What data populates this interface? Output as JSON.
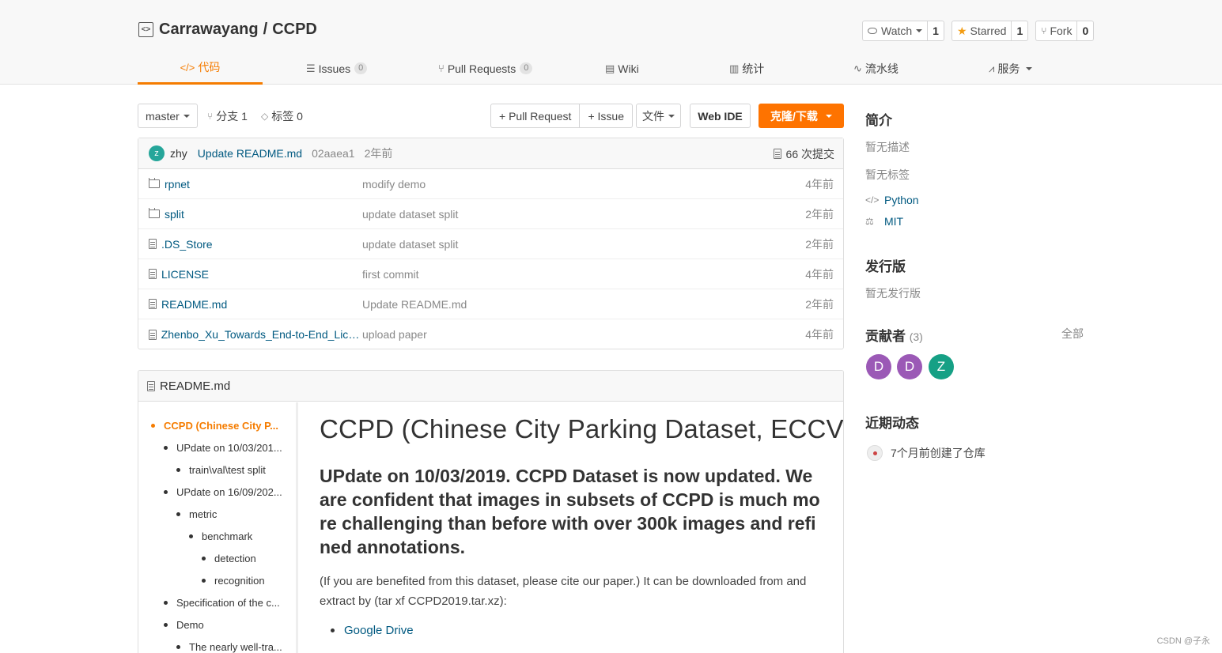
{
  "repo": {
    "owner": "Carrawayang",
    "separator": "/",
    "name": "CCPD",
    "watch_label": "Watch",
    "watch_count": "1",
    "star_label": "Starred",
    "star_count": "1",
    "fork_label": "Fork",
    "fork_count": "0"
  },
  "tabs": [
    {
      "label": "代码",
      "icon": "code-icon"
    },
    {
      "label": "Issues",
      "count": "0",
      "icon": "issues-icon"
    },
    {
      "label": "Pull Requests",
      "count": "0",
      "icon": "pull-request-icon"
    },
    {
      "label": "Wiki",
      "icon": "wiki-icon"
    },
    {
      "label": "统计",
      "icon": "stats-icon"
    },
    {
      "label": "流水线",
      "icon": "pipeline-icon"
    },
    {
      "label": "服务",
      "icon": "service-icon"
    }
  ],
  "toolbar": {
    "branch": "master",
    "branches_label": "分支 1",
    "tags_label": "标签 0",
    "pull_request": "+ Pull Request",
    "issue": "+ Issue",
    "file": "文件",
    "web_ide": "Web IDE",
    "clone": "克隆/下载"
  },
  "last_commit": {
    "avatar_letter": "z",
    "author": "zhy",
    "message": "Update README.md",
    "sha": "02aaea1",
    "time": "2年前",
    "commits": "66 次提交"
  },
  "files": [
    {
      "name": "rpnet",
      "type": "folder",
      "message": "modify demo",
      "time": "4年前"
    },
    {
      "name": "split",
      "type": "folder",
      "message": "update dataset split",
      "time": "2年前"
    },
    {
      "name": ".DS_Store",
      "type": "file",
      "message": "update dataset split",
      "time": "2年前"
    },
    {
      "name": "LICENSE",
      "type": "file",
      "message": "first commit",
      "time": "4年前"
    },
    {
      "name": "README.md",
      "type": "file",
      "message": "Update README.md",
      "time": "2年前"
    },
    {
      "name": "Zhenbo_Xu_Towards_End-to-End_Licen...",
      "type": "file",
      "message": "upload paper",
      "time": "4年前"
    }
  ],
  "readme": {
    "filename": "README.md",
    "toc": [
      {
        "text": "CCPD (Chinese City P...",
        "level": 0
      },
      {
        "text": "UPdate on 10/03/201...",
        "level": 1
      },
      {
        "text": "train\\val\\test split",
        "level": 2
      },
      {
        "text": "UPdate on 16/09/202...",
        "level": 1
      },
      {
        "text": "metric",
        "level": 2
      },
      {
        "text": "benchmark",
        "level": 3
      },
      {
        "text": "detection",
        "level": 4
      },
      {
        "text": "recognition",
        "level": 4
      },
      {
        "text": "Specification of the c...",
        "level": 1
      },
      {
        "text": "Demo",
        "level": 1
      },
      {
        "text": "The nearly well-tra...",
        "level": 2
      }
    ],
    "h1": "CCPD (Chinese City Parking Dataset, ECCV)",
    "h2": "UPdate on 10/03/2019. CCPD Dataset is now updated. We are confident that images in subsets of CCPD is much more challenging than before with over 300k images and refined annotations.",
    "paragraph": "(If you are benefited from this dataset, please cite our paper.) It can be downloaded from and extract by (tar xf CCPD2019.tar.xz):",
    "links": [
      "Google Drive"
    ]
  },
  "sidebar": {
    "intro_title": "简介",
    "no_description": "暂无描述",
    "no_tags": "暂无标签",
    "language": "Python",
    "license": "MIT",
    "release_title": "发行版",
    "no_release": "暂无发行版",
    "contributors_title": "贡献者",
    "contributors_count": "(3)",
    "all_label": "全部",
    "contributors": [
      {
        "letter": "D",
        "color": "#9b59b6"
      },
      {
        "letter": "D",
        "color": "#9b59b6"
      },
      {
        "letter": "Z",
        "color": "#16a085"
      }
    ],
    "activity_title": "近期动态",
    "activity_text": "7个月前创建了仓库"
  },
  "watermark": "CSDN @子永",
  "colors": {
    "accent": "#fe7300",
    "link": "#005980"
  }
}
